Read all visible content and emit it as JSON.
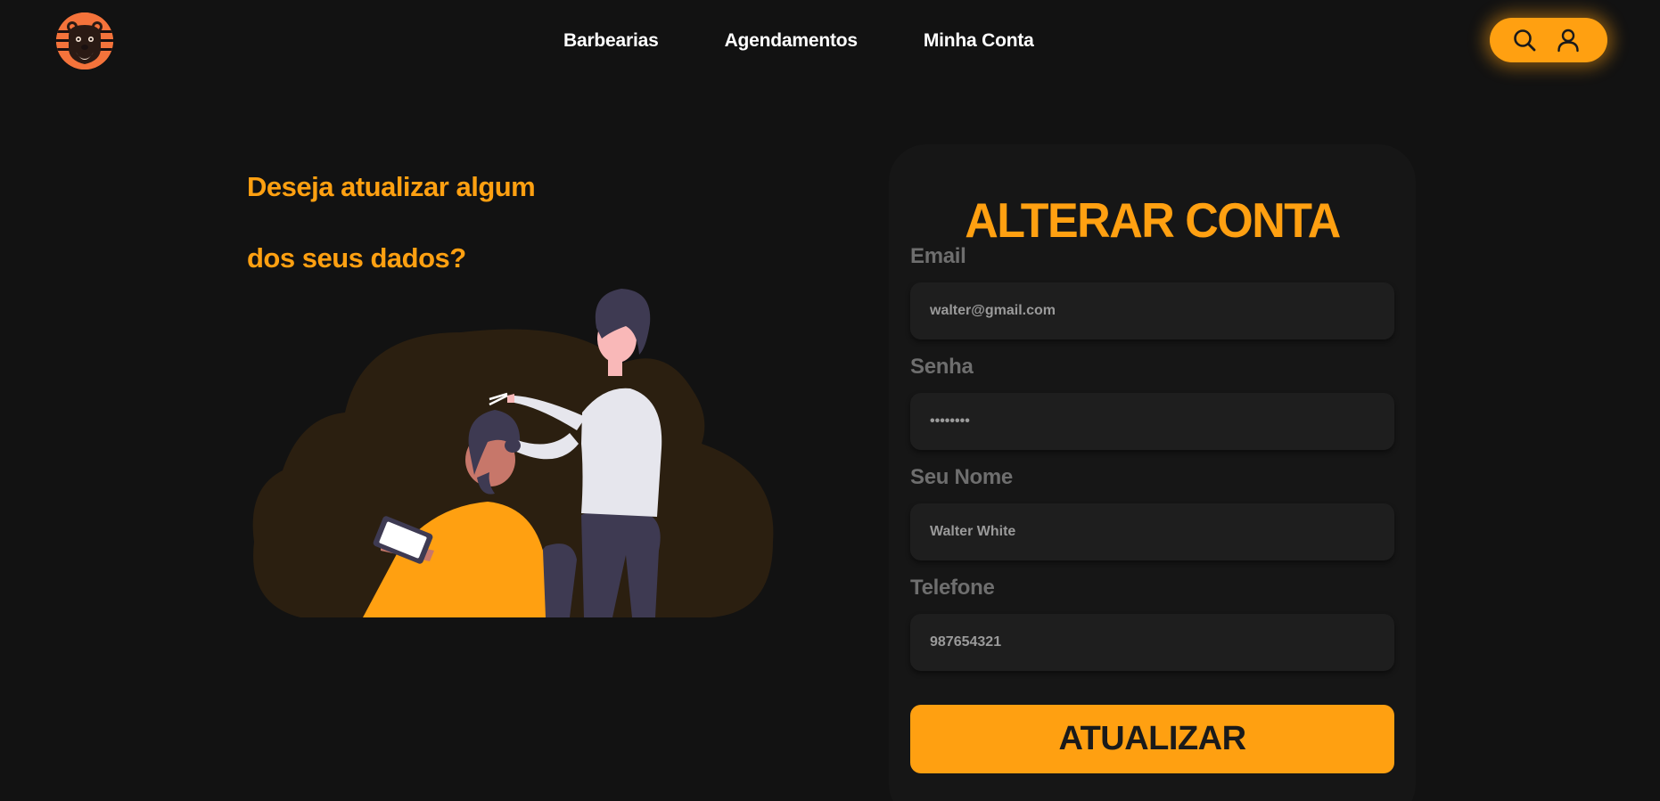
{
  "header": {
    "logo_icon": "bear-barber-logo-icon",
    "nav": [
      {
        "label": "Barbearias"
      },
      {
        "label": "Agendamentos"
      },
      {
        "label": "Minha Conta"
      }
    ],
    "actions": {
      "search_icon": "search-icon",
      "user_icon": "user-icon"
    }
  },
  "hero": {
    "headline_line1": "Deseja atualizar algum",
    "headline_line2": "dos seus dados?",
    "illustration_icon": "barber-cutting-hair-illustration"
  },
  "form": {
    "title": "ALTERAR CONTA",
    "fields": [
      {
        "label": "Email",
        "value": "walter@gmail.com",
        "type": "email"
      },
      {
        "label": "Senha",
        "value": "********",
        "type": "password"
      },
      {
        "label": "Seu Nome",
        "value": "Walter White",
        "type": "text"
      },
      {
        "label": "Telefone",
        "value": "987654321",
        "type": "tel"
      }
    ],
    "submit_label": "ATUALIZAR"
  },
  "colors": {
    "background": "#121212",
    "accent": "#ffa011",
    "card": "#161616",
    "input": "#1e1e1e",
    "label": "#6e6e6e",
    "logo_bg": "#f4733b",
    "blob": "#2b1f10"
  }
}
